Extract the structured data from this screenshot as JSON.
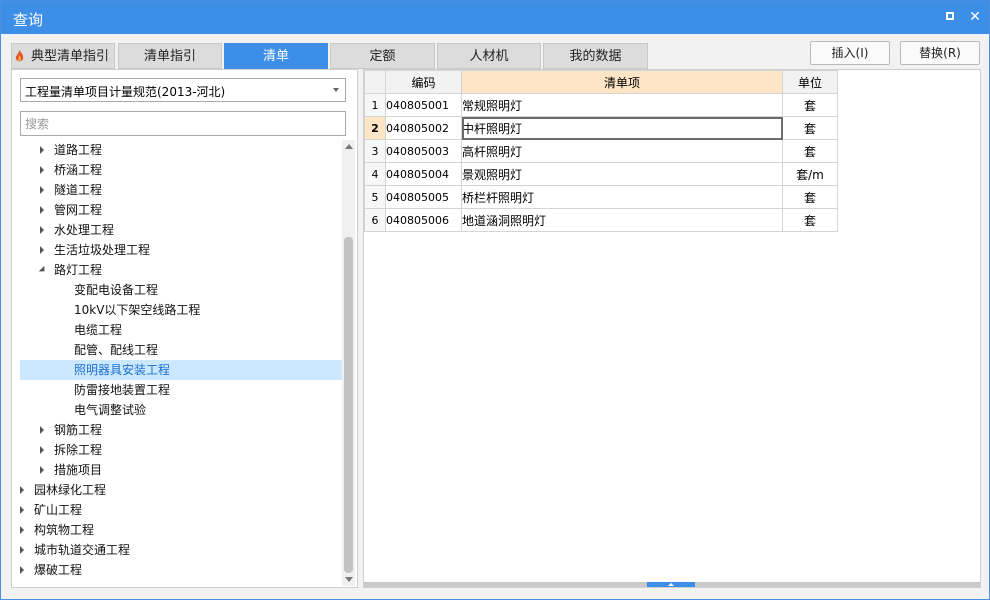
{
  "window": {
    "title": "查询",
    "maximize_icon": "maximize-icon",
    "close_icon": "close-icon",
    "close_glyph": "✕"
  },
  "tabs": [
    {
      "label": "典型清单指引",
      "active": false,
      "icon": "flame-icon"
    },
    {
      "label": "清单指引",
      "active": false
    },
    {
      "label": "清单",
      "active": true
    },
    {
      "label": "定额",
      "active": false
    },
    {
      "label": "人材机",
      "active": false
    },
    {
      "label": "我的数据",
      "active": false
    }
  ],
  "actions": {
    "insert_label": "插入(I)",
    "replace_label": "替换(R)"
  },
  "left": {
    "spec_selected": "工程量清单项目计量规范(2013-河北)",
    "search_placeholder": "搜索",
    "tree": [
      {
        "label": "道路工程",
        "toggle": "collapsed"
      },
      {
        "label": "桥涵工程",
        "toggle": "collapsed"
      },
      {
        "label": "隧道工程",
        "toggle": "collapsed"
      },
      {
        "label": "管网工程",
        "toggle": "collapsed"
      },
      {
        "label": "水处理工程",
        "toggle": "collapsed"
      },
      {
        "label": "生活垃圾处理工程",
        "toggle": "collapsed"
      },
      {
        "label": "路灯工程",
        "toggle": "expanded"
      },
      {
        "label": "变配电设备工程",
        "toggle": "none"
      },
      {
        "label": "10kV以下架空线路工程",
        "toggle": "none"
      },
      {
        "label": "电缆工程",
        "toggle": "none"
      },
      {
        "label": "配管、配线工程",
        "toggle": "none"
      },
      {
        "label": "照明器具安装工程",
        "toggle": "none",
        "selected": true
      },
      {
        "label": "防雷接地装置工程",
        "toggle": "none"
      },
      {
        "label": "电气调整试验",
        "toggle": "none"
      },
      {
        "label": "钢筋工程",
        "toggle": "collapsed"
      },
      {
        "label": "拆除工程",
        "toggle": "collapsed"
      },
      {
        "label": "措施项目",
        "toggle": "collapsed"
      },
      {
        "label": "园林绿化工程",
        "toggle": "collapsed"
      },
      {
        "label": "矿山工程",
        "toggle": "collapsed"
      },
      {
        "label": "构筑物工程",
        "toggle": "collapsed"
      },
      {
        "label": "城市轨道交通工程",
        "toggle": "collapsed"
      },
      {
        "label": "爆破工程",
        "toggle": "collapsed"
      }
    ]
  },
  "grid": {
    "columns": {
      "num": "",
      "code": "编码",
      "name": "清单项",
      "unit": "单位"
    },
    "current_row": 2,
    "rows": [
      {
        "num": "1",
        "code": "040805001",
        "name": "常规照明灯",
        "unit": "套"
      },
      {
        "num": "2",
        "code": "040805002",
        "name": "中杆照明灯",
        "unit": "套"
      },
      {
        "num": "3",
        "code": "040805003",
        "name": "高杆照明灯",
        "unit": "套"
      },
      {
        "num": "4",
        "code": "040805004",
        "name": "景观照明灯",
        "unit": "套/m"
      },
      {
        "num": "5",
        "code": "040805005",
        "name": "桥栏杆照明灯",
        "unit": "套"
      },
      {
        "num": "6",
        "code": "040805006",
        "name": "地道涵洞照明灯",
        "unit": "套"
      }
    ]
  },
  "colors": {
    "accent": "#3d8ee6",
    "header_highlight": "#fde5c6",
    "selection": "#cce8ff",
    "flame": "#e8552a"
  }
}
